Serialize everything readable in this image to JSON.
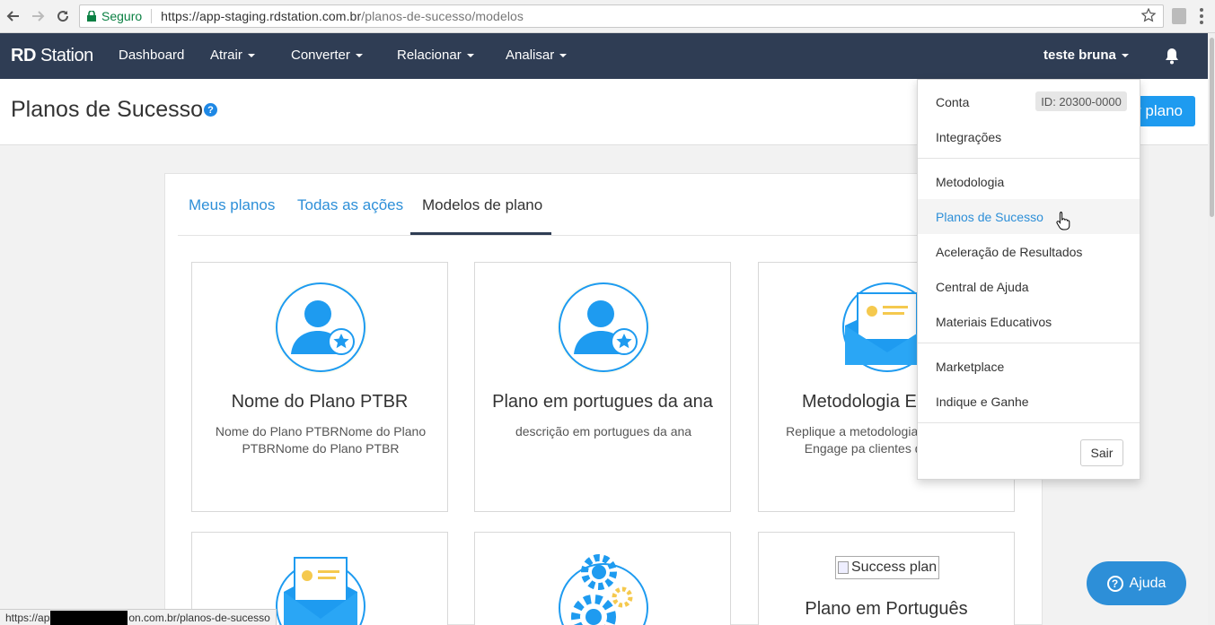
{
  "browser": {
    "secure_label": "Seguro",
    "url_host": "https://app-staging.rdstation.com.br",
    "url_path": "/planos-de-sucesso/modelos",
    "status_url_prefix": "https://ap",
    "status_url_suffix": "on.com.br/planos-de-sucesso"
  },
  "app": {
    "logo_bold": "RD",
    "logo_rest": " Station",
    "nav": {
      "dashboard": "Dashboard",
      "atrair": "Atrair",
      "converter": "Converter",
      "relacionar": "Relacionar",
      "analisar": "Analisar"
    },
    "user_name": "teste bruna"
  },
  "page": {
    "title": "Planos de Sucesso",
    "help_glyph": "?",
    "new_plan_button": "r plano"
  },
  "tabs": {
    "meus_planos": "Meus planos",
    "todas_acoes": "Todas as ações",
    "modelos": "Modelos de plano"
  },
  "cards": [
    {
      "title": "Nome do Plano PTBR",
      "description": "Nome do Plano PTBRNome do Plano PTBRNome do Plano PTBR",
      "icon": "user-star-icon"
    },
    {
      "title": "Plano em portugues da ana",
      "description": "descrição em portugues da ana",
      "icon": "user-star-icon"
    },
    {
      "title": "Metodologia E",
      "description": "Replique a metodologia consultorias Engage pa clientes da sua ag",
      "icon": "envelope-icon"
    },
    {
      "title": "",
      "description": "",
      "icon": "envelope-icon"
    },
    {
      "title": "",
      "description": "",
      "icon": "gears-icon"
    },
    {
      "title": "Plano em Português",
      "description": "",
      "image_alt": "Success plan"
    }
  ],
  "dropdown": {
    "conta": "Conta",
    "account_id": "ID: 20300-0000",
    "integracoes": "Integrações",
    "metodologia": "Metodologia",
    "planos_sucesso": "Planos de Sucesso",
    "aceleracao": "Aceleração de Resultados",
    "central_ajuda": "Central de Ajuda",
    "materiais": "Materiais Educativos",
    "marketplace": "Marketplace",
    "indique": "Indique e Ganhe",
    "sair": "Sair"
  },
  "help_fab": {
    "label": "Ajuda",
    "glyph": "?"
  },
  "colors": {
    "nav_bg": "#2f3d54",
    "accent": "#2d8fd8",
    "primary_button": "#1e9bf0"
  }
}
